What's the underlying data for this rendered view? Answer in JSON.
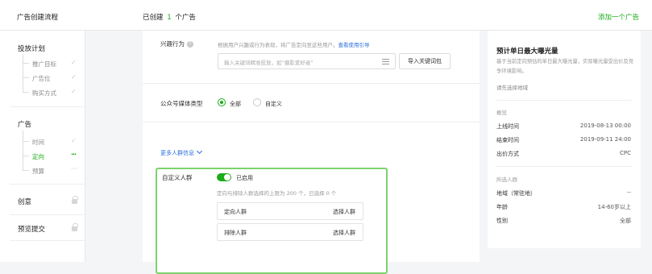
{
  "topbar": {
    "flow_title": "广告创建流程",
    "created_prefix": "已创建",
    "created_count": "1",
    "created_suffix": "个广告",
    "add_ad": "添加一个广告"
  },
  "sidebar": {
    "sections": [
      {
        "title": "投放计划",
        "items": [
          {
            "label": "推广目标",
            "status": "✓"
          },
          {
            "label": "广告位",
            "status": "✓"
          },
          {
            "label": "购买方式",
            "status": "✓"
          }
        ]
      },
      {
        "title": "广告",
        "items": [
          {
            "label": "时间",
            "status": "✓"
          },
          {
            "label": "定向",
            "status": "···"
          },
          {
            "label": "预算",
            "status": "···"
          }
        ]
      },
      {
        "title": "创意"
      },
      {
        "title": "预览提交"
      }
    ]
  },
  "interest": {
    "label": "兴趣行为",
    "help_icon": "?",
    "hint": "根据用户兴趣或行为表现，将广告定向至这些用户。",
    "hint_link": "查看使用引导",
    "input_placeholder": "输入关键词精准投放，如“摄影爱好者”",
    "import_button": "导入关键词包"
  },
  "media_type": {
    "label": "公众号媒体类型",
    "options": [
      "全部",
      "自定义"
    ],
    "selected": "全部"
  },
  "more_info": "更多人群信息",
  "custom_audience": {
    "label": "自定义人群",
    "toggle_label": "已启用",
    "note": "定向与排除人群选择的上限为 200 个，已选择 0 个",
    "rows": [
      {
        "name": "定向人群",
        "action": "选择人群"
      },
      {
        "name": "排除人群",
        "action": "选择人群"
      }
    ]
  },
  "panel": {
    "title": "预计单日最大曝光量",
    "desc": "基于当前定向预估的单日最大曝光量，实际曝光量受出价及竞争环境影响。",
    "pick": "请先选择地域",
    "overview_title": "概览",
    "overview": [
      {
        "k": "上线时间",
        "v": "2019-08-13 00:00"
      },
      {
        "k": "结束时间",
        "v": "2019-09-11 24:00"
      },
      {
        "k": "出价方式",
        "v": "CPC"
      }
    ],
    "audience_title": "所选人群",
    "audience": [
      {
        "k": "地域（常驻地）",
        "v": "--"
      },
      {
        "k": "年龄",
        "v": "14-60岁以上"
      },
      {
        "k": "性别",
        "v": "全部"
      }
    ]
  }
}
